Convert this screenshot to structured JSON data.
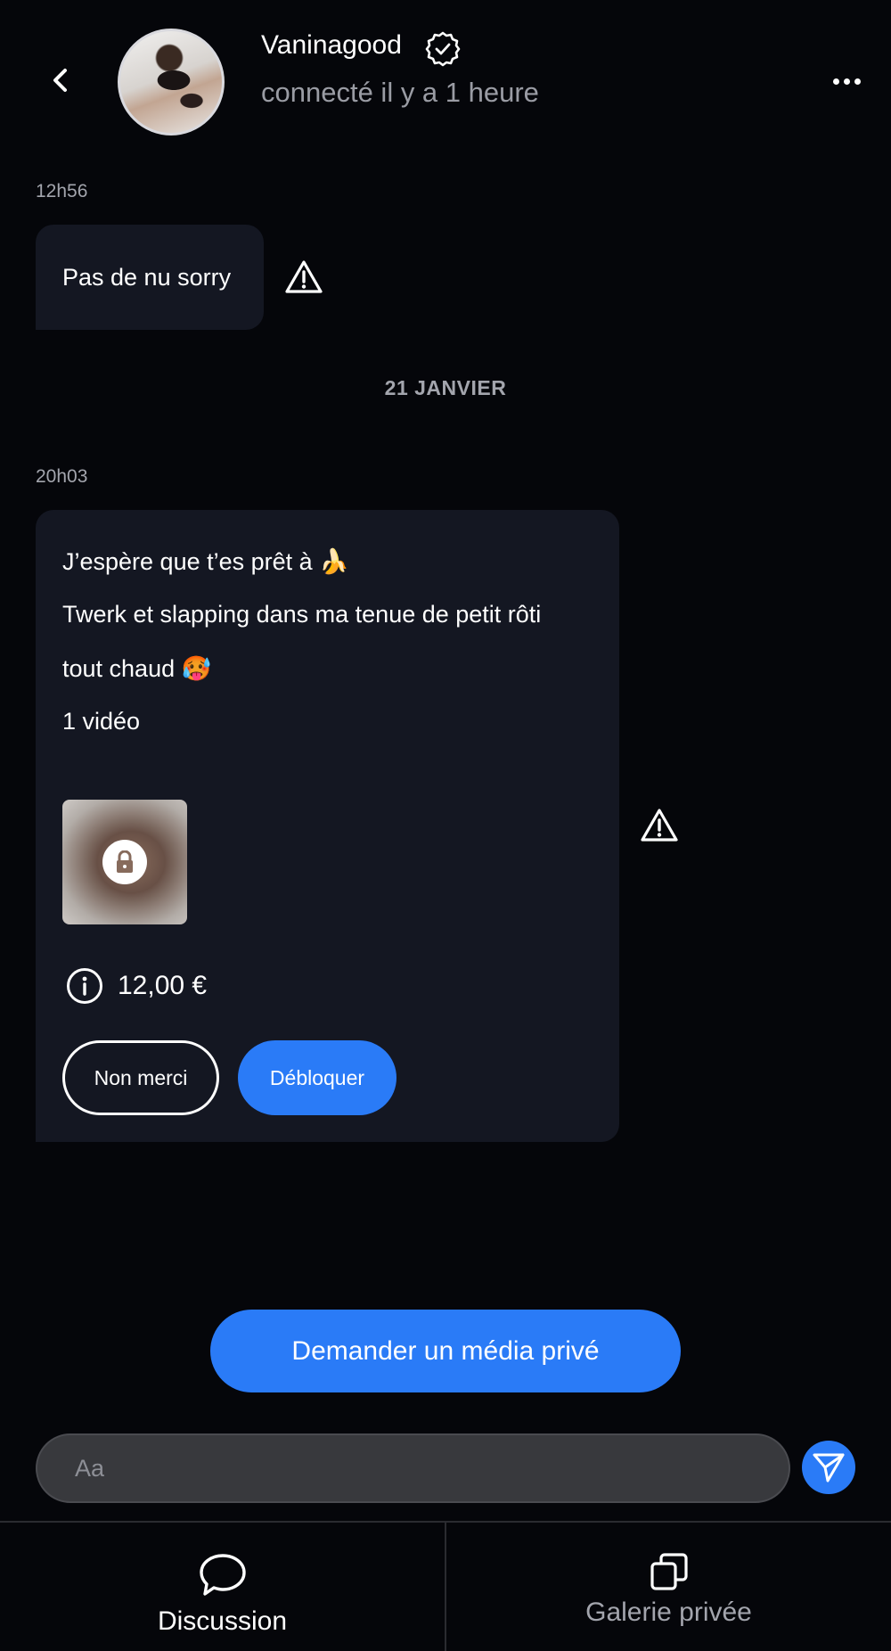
{
  "header": {
    "name": "Vaninagood",
    "status": "connecté il y a 1 heure"
  },
  "messages": {
    "first": {
      "time": "12h56",
      "text": "Pas de nu sorry"
    },
    "date_separator": "21 JANVIER",
    "ppv": {
      "time": "20h03",
      "line1": "J’espère que t’es prêt à 🍌",
      "line2": "Twerk et slapping dans ma tenue de petit rôti",
      "line3": "tout chaud 🥵",
      "media_count": "1 vidéo",
      "price": "12,00 €",
      "decline_label": "Non merci",
      "unlock_label": "Débloquer"
    }
  },
  "request_button_label": "Demander un média privé",
  "composer": {
    "placeholder": "Aa"
  },
  "tabs": [
    {
      "label": "Discussion",
      "icon": "chat-bubble-icon",
      "active": true
    },
    {
      "label": "Galerie privée",
      "icon": "gallery-icon",
      "active": false
    }
  ],
  "colors": {
    "accent": "#2a7bf7",
    "bubble": "#141722",
    "background": "#05060a"
  }
}
